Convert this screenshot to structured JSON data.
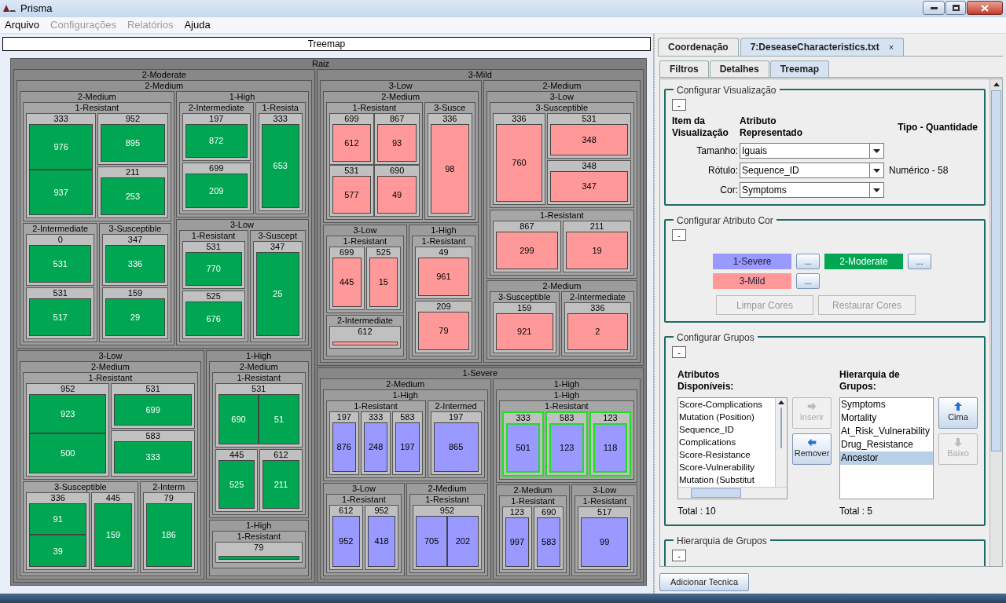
{
  "window": {
    "title": "Prisma"
  },
  "menu": [
    {
      "label": "Arquivo",
      "disabled": false
    },
    {
      "label": "Configurações",
      "disabled": true
    },
    {
      "label": "Relatórios",
      "disabled": true
    },
    {
      "label": "Ajuda",
      "disabled": false
    }
  ],
  "treemap": {
    "title": "Treemap",
    "root": {
      "label": "Raiz",
      "children": [
        {
          "label": "2-Moderate",
          "color": "#00a651",
          "children": [
            {
              "label": "2-Medium",
              "children": [
                {
                  "label": "2-Medium",
                  "children": [
                    {
                      "label": "1-Resistant",
                      "children": [
                        {
                          "label": "333",
                          "kind": "leaves",
                          "selected": false,
                          "leaves": [
                            "976",
                            "937"
                          ]
                        },
                        {
                          "label": "952",
                          "kind": "leaves",
                          "selected": false,
                          "leaves": [
                            "895"
                          ]
                        },
                        {
                          "label": "211",
                          "kind": "leaves",
                          "selected": false,
                          "leaves": [
                            "253"
                          ]
                        }
                      ]
                    },
                    {
                      "label": "2-Intermediate",
                      "children": [
                        {
                          "label": "0",
                          "kind": "leaves",
                          "selected": false,
                          "leaves": [
                            "531"
                          ]
                        },
                        {
                          "label": "531",
                          "kind": "leaves",
                          "selected": false,
                          "leaves": [
                            "517"
                          ]
                        }
                      ]
                    },
                    {
                      "label": "3-Susceptible",
                      "children": [
                        {
                          "label": "347",
                          "kind": "leaves",
                          "selected": false,
                          "leaves": [
                            "336"
                          ]
                        },
                        {
                          "label": "159",
                          "kind": "leaves",
                          "selected": false,
                          "leaves": [
                            "29"
                          ]
                        }
                      ]
                    }
                  ]
                },
                {
                  "label": "1-High",
                  "children": [
                    {
                      "label": "2-Intermediate",
                      "children": [
                        {
                          "label": "197",
                          "kind": "leaves",
                          "selected": false,
                          "leaves": [
                            "872"
                          ]
                        },
                        {
                          "label": "699",
                          "kind": "leaves",
                          "selected": false,
                          "leaves": [
                            "209"
                          ]
                        }
                      ]
                    },
                    {
                      "label": "1-Resista",
                      "children": [
                        {
                          "label": "333",
                          "kind": "leaves",
                          "selected": false,
                          "leaves": [
                            "653"
                          ]
                        }
                      ]
                    }
                  ]
                },
                {
                  "label": "3-Low",
                  "children": [
                    {
                      "label": "1-Resistant",
                      "children": [
                        {
                          "label": "531",
                          "kind": "leaves",
                          "selected": false,
                          "leaves": [
                            "770"
                          ]
                        },
                        {
                          "label": "525",
                          "kind": "leaves",
                          "selected": false,
                          "leaves": [
                            "676"
                          ]
                        }
                      ]
                    },
                    {
                      "label": "3-Suscept",
                      "children": [
                        {
                          "label": "347",
                          "kind": "leaves",
                          "selected": false,
                          "leaves": [
                            "25"
                          ]
                        }
                      ]
                    }
                  ]
                }
              ]
            },
            {
              "label": "3-Low",
              "children": [
                {
                  "label": "2-Medium",
                  "children": [
                    {
                      "label": "1-Resistant",
                      "children": [
                        {
                          "label": "952",
                          "kind": "leaves",
                          "selected": false,
                          "leaves": [
                            "923",
                            "500"
                          ]
                        },
                        {
                          "label": "531",
                          "kind": "leaves",
                          "selected": false,
                          "leaves": [
                            "699"
                          ]
                        },
                        {
                          "label": "583",
                          "kind": "leaves",
                          "selected": false,
                          "leaves": [
                            "333"
                          ]
                        }
                      ]
                    },
                    {
                      "label": "3-Susceptible",
                      "children": [
                        {
                          "label": "336",
                          "kind": "leaves",
                          "selected": false,
                          "leaves": [
                            "91",
                            "39"
                          ]
                        },
                        {
                          "label": "445",
                          "kind": "leaves",
                          "selected": false,
                          "leaves": [
                            "159"
                          ]
                        }
                      ]
                    },
                    {
                      "label": "2-Interm",
                      "children": [
                        {
                          "label": "79",
                          "kind": "leaves",
                          "selected": false,
                          "leaves": [
                            "186"
                          ]
                        }
                      ]
                    }
                  ]
                }
              ]
            },
            {
              "label": "1-High",
              "children": [
                {
                  "label": "2-Medium",
                  "children": [
                    {
                      "label": "1-Resistant",
                      "children": [
                        {
                          "label": "531",
                          "kind": "leaves",
                          "selected": false,
                          "leaves": [
                            "690",
                            "51"
                          ]
                        },
                        {
                          "label": "445",
                          "kind": "leaves",
                          "selected": false,
                          "leaves": [
                            "525"
                          ]
                        },
                        {
                          "label": "612",
                          "kind": "leaves",
                          "selected": false,
                          "leaves": [
                            "211"
                          ]
                        }
                      ]
                    }
                  ]
                },
                {
                  "label": "1-High",
                  "children": [
                    {
                      "label": "1-Resistant",
                      "children": [
                        {
                          "label": "79",
                          "kind": "bar",
                          "selected": false
                        }
                      ]
                    }
                  ]
                }
              ]
            }
          ]
        },
        {
          "label": "3-Mild",
          "color": "#ff9999",
          "children": [
            {
              "label": "3-Low",
              "children": [
                {
                  "label": "2-Medium",
                  "children": [
                    {
                      "label": "1-Resistant",
                      "children": [
                        {
                          "label": "699",
                          "kind": "leaves",
                          "selected": false,
                          "leaves": [
                            "612"
                          ]
                        },
                        {
                          "label": "867",
                          "kind": "leaves",
                          "selected": false,
                          "leaves": [
                            "93"
                          ]
                        },
                        {
                          "label": "531",
                          "kind": "leaves",
                          "selected": false,
                          "leaves": [
                            "577"
                          ]
                        },
                        {
                          "label": "690",
                          "kind": "leaves",
                          "selected": false,
                          "leaves": [
                            "49"
                          ]
                        }
                      ]
                    },
                    {
                      "label": "3-Susce",
                      "children": [
                        {
                          "label": "336",
                          "kind": "leaves",
                          "selected": false,
                          "leaves": [
                            "98"
                          ]
                        }
                      ]
                    }
                  ]
                },
                {
                  "label": "3-Low",
                  "children": [
                    {
                      "label": "1-Resistant",
                      "children": [
                        {
                          "label": "699",
                          "kind": "leaves",
                          "selected": false,
                          "leaves": [
                            "445"
                          ]
                        },
                        {
                          "label": "525",
                          "kind": "leaves",
                          "selected": false,
                          "leaves": [
                            "15"
                          ]
                        }
                      ]
                    },
                    {
                      "label": "2-Intermediate",
                      "children": [
                        {
                          "label": "612",
                          "kind": "bar",
                          "selected": false
                        }
                      ]
                    }
                  ]
                },
                {
                  "label": "1-High",
                  "children": [
                    {
                      "label": "1-Resistant",
                      "children": [
                        {
                          "label": "49",
                          "kind": "leaves",
                          "selected": false,
                          "leaves": [
                            "961"
                          ]
                        },
                        {
                          "label": "209",
                          "kind": "leaves",
                          "selected": false,
                          "leaves": [
                            "79"
                          ]
                        }
                      ]
                    }
                  ]
                }
              ]
            },
            {
              "label": "2-Medium",
              "children": [
                {
                  "label": "3-Low",
                  "children": [
                    {
                      "label": "3-Susceptible",
                      "children": [
                        {
                          "label": "336",
                          "kind": "leaves",
                          "selected": false,
                          "leaves": [
                            "760"
                          ]
                        },
                        {
                          "label": "531",
                          "kind": "leaves",
                          "selected": false,
                          "leaves": [
                            "348"
                          ]
                        },
                        {
                          "label": "348",
                          "kind": "leaves",
                          "selected": false,
                          "leaves": [
                            "347"
                          ]
                        }
                      ]
                    },
                    {
                      "label": "1-Resistant",
                      "children": [
                        {
                          "label": "867",
                          "kind": "leaves",
                          "selected": false,
                          "leaves": [
                            "299"
                          ]
                        },
                        {
                          "label": "211",
                          "kind": "leaves",
                          "selected": false,
                          "leaves": [
                            "19"
                          ]
                        }
                      ]
                    }
                  ]
                },
                {
                  "label": "2-Medium",
                  "children": [
                    {
                      "label": "3-Susceptible",
                      "children": [
                        {
                          "label": "159",
                          "kind": "leaves",
                          "selected": false,
                          "leaves": [
                            "921"
                          ]
                        }
                      ]
                    },
                    {
                      "label": "2-Intermediate",
                      "children": [
                        {
                          "label": "336",
                          "kind": "leaves",
                          "selected": false,
                          "leaves": [
                            "2"
                          ]
                        }
                      ]
                    }
                  ]
                }
              ]
            }
          ]
        },
        {
          "label": "1-Severe",
          "color": "#9999ff",
          "children": [
            {
              "label": "2-Medium",
              "children": [
                {
                  "label": "1-High",
                  "children": [
                    {
                      "label": "1-Resistant",
                      "children": [
                        {
                          "label": "197",
                          "kind": "leaves",
                          "selected": false,
                          "leaves": [
                            "876"
                          ]
                        },
                        {
                          "label": "333",
                          "kind": "leaves",
                          "selected": false,
                          "leaves": [
                            "248"
                          ]
                        },
                        {
                          "label": "583",
                          "kind": "leaves",
                          "selected": false,
                          "leaves": [
                            "197"
                          ]
                        }
                      ]
                    },
                    {
                      "label": "2-Intermed",
                      "children": [
                        {
                          "label": "197",
                          "kind": "leaves",
                          "selected": false,
                          "leaves": [
                            "865"
                          ]
                        }
                      ]
                    }
                  ]
                },
                {
                  "label": "3-Low",
                  "children": [
                    {
                      "label": "1-Resistant",
                      "children": [
                        {
                          "label": "612",
                          "kind": "leaves",
                          "selected": false,
                          "leaves": [
                            "952"
                          ]
                        },
                        {
                          "label": "952",
                          "kind": "leaves",
                          "selected": false,
                          "leaves": [
                            "418"
                          ]
                        }
                      ]
                    }
                  ]
                },
                {
                  "label": "2-Medium",
                  "children": [
                    {
                      "label": "1-Resistant",
                      "children": [
                        {
                          "label": "952",
                          "kind": "leaves",
                          "selected": false,
                          "leaves": [
                            "705",
                            "202"
                          ]
                        }
                      ]
                    }
                  ]
                }
              ]
            },
            {
              "label": "1-High",
              "children": [
                {
                  "label": "1-High",
                  "children": [
                    {
                      "label": "1-Resistant",
                      "children": [
                        {
                          "label": "333",
                          "kind": "leaves",
                          "selected": true,
                          "leaves": [
                            "501"
                          ]
                        },
                        {
                          "label": "583",
                          "kind": "leaves",
                          "selected": true,
                          "leaves": [
                            "123"
                          ]
                        },
                        {
                          "label": "123",
                          "kind": "leaves",
                          "selected": true,
                          "leaves": [
                            "118"
                          ]
                        }
                      ]
                    }
                  ]
                },
                {
                  "label": "2-Medium",
                  "children": [
                    {
                      "label": "1-Resistant",
                      "children": [
                        {
                          "label": "123",
                          "kind": "leaves",
                          "selected": false,
                          "leaves": [
                            "997"
                          ]
                        },
                        {
                          "label": "690",
                          "kind": "leaves",
                          "selected": false,
                          "leaves": [
                            "583"
                          ]
                        }
                      ]
                    }
                  ]
                },
                {
                  "label": "3-Low",
                  "children": [
                    {
                      "label": "1-Resistant",
                      "children": [
                        {
                          "label": "517",
                          "kind": "leaves",
                          "selected": false,
                          "leaves": [
                            "99"
                          ]
                        }
                      ]
                    }
                  ]
                }
              ]
            }
          ]
        }
      ]
    }
  },
  "tabs": [
    {
      "label": "Coordenação",
      "selected": false
    },
    {
      "label": "7:DeseaseCharacteristics.txt",
      "close": "×",
      "selected": true
    }
  ],
  "subtabs": [
    {
      "label": "Filtros",
      "selected": false
    },
    {
      "label": "Detalhes",
      "selected": false
    },
    {
      "label": "Treemap",
      "selected": true
    }
  ],
  "visualization": {
    "title": "Configurar Visualização",
    "collapse": "-",
    "headers": [
      "Item da Visualização",
      "Atributo Representado",
      "Tipo - Quantidade"
    ],
    "rows": [
      {
        "label": "Tamanho:",
        "value": "Iguais"
      },
      {
        "label": "Rótulo:",
        "value": "Sequence_ID",
        "info": "Numérico - 58"
      },
      {
        "label": "Cor:",
        "value": "Symptoms"
      }
    ]
  },
  "color_config": {
    "title": "Configurar Atributo Cor",
    "collapse": "-",
    "items": [
      {
        "label": "1-Severe",
        "color": "#9999ff",
        "button": "..."
      },
      {
        "label": "2-Moderate",
        "color": "#00a651",
        "button": "..."
      },
      {
        "label": "3-Mild",
        "color": "#ff9999",
        "button": "..."
      }
    ],
    "buttons": [
      {
        "label": "Limpar Cores",
        "disabled": true
      },
      {
        "label": "Restaurar Cores",
        "disabled": true
      }
    ]
  },
  "groups": {
    "title": "Configurar Grupos",
    "collapse": "-",
    "available": {
      "heading": "Atributos Disponíveis:",
      "items": [
        "Score-Complications",
        "Mutation (Position)",
        "Sequence_ID",
        "Complications",
        "Score-Resistance",
        "Score-Vulnerability",
        "Mutation (Substitut"
      ],
      "total": "Total : 10"
    },
    "move_buttons": [
      {
        "label": "Inserir",
        "disabled": true
      },
      {
        "label": "Remover",
        "disabled": false
      }
    ],
    "hierarchy": {
      "heading": "Hierarquia de Grupos:",
      "items": [
        {
          "label": "Symptoms",
          "selected": false
        },
        {
          "label": "Mortality",
          "selected": false
        },
        {
          "label": "At_Risk_Vulnerability",
          "selected": false
        },
        {
          "label": "Drug_Resistance",
          "selected": false
        },
        {
          "label": "Ancestor",
          "selected": true
        }
      ],
      "total": "Total : 5"
    },
    "order_buttons": [
      {
        "label": "Cima",
        "disabled": false
      },
      {
        "label": "Baixo",
        "disabled": true
      }
    ]
  },
  "hierarchy_section": {
    "title": "Hierarquia de Grupos",
    "collapse": "-"
  },
  "add_button": "Adicionar Tecnica"
}
